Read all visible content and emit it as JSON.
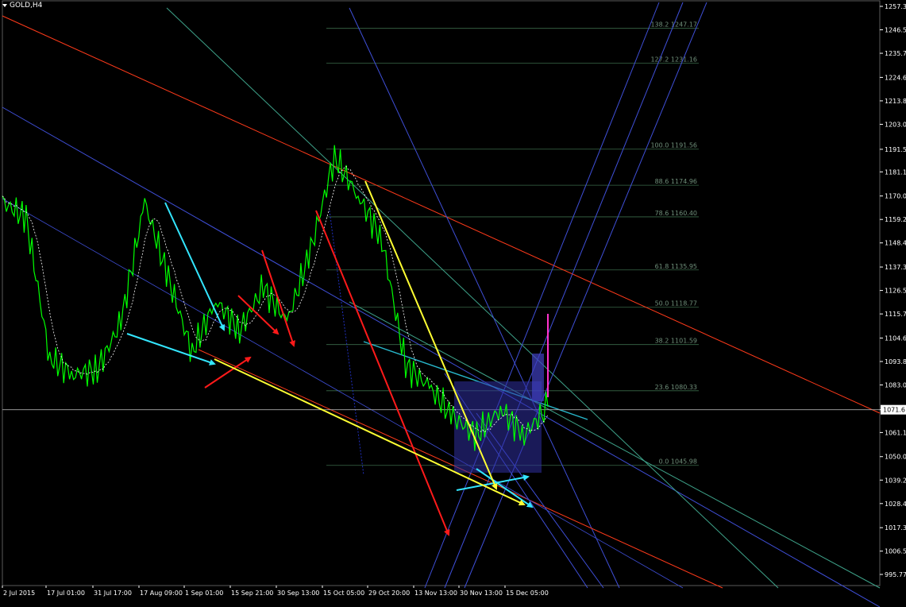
{
  "window": {
    "symbol_label": "GOLD,H4"
  },
  "chart_data": {
    "type": "line",
    "title": "GOLD,H4",
    "background": "#000000",
    "price_color": "#00ff00",
    "ylim": [
      995.77,
      1257.3
    ],
    "y_ticks": [
      "1257.3",
      "1246.5",
      "1235.7",
      "1224.6",
      "1213.8",
      "1203.0",
      "1191.5",
      "1181.1",
      "1170.0",
      "1159.2",
      "1148.4",
      "1137.3",
      "1126.5",
      "1115.7",
      "1104.6",
      "1093.8",
      "1083.0",
      "1071.6",
      "1061.1",
      "1050.0",
      "1039.2",
      "1028.4",
      "1017.3",
      "1006.5",
      "995.77"
    ],
    "current_price_label": "1071.6",
    "x_ticks": [
      "2 Jul 2015",
      "17 Jul 01:00",
      "31 Jul 17:00",
      "17 Aug 09:00",
      "1 Sep 01:00",
      "15 Sep 21:00",
      "30 Sep 13:00",
      "15 Oct 05:00",
      "29 Oct 20:00",
      "13 Nov 13:00",
      "30 Nov 13:00",
      "15 Dec 05:00"
    ],
    "series": [
      {
        "x": [
          "2 Jul 2015",
          "9 Jul",
          "17 Jul",
          "24 Jul",
          "31 Jul",
          "7 Aug",
          "17 Aug",
          "24 Aug",
          "1 Sep",
          "8 Sep",
          "15 Sep",
          "22 Sep",
          "30 Sep",
          "7 Oct",
          "15 Oct",
          "22 Oct",
          "29 Oct",
          "5 Nov",
          "13 Nov",
          "20 Nov",
          "30 Nov",
          "7 Dec",
          "15 Dec",
          "22 Dec"
        ],
        "values": [
          1167,
          1160,
          1095,
          1088,
          1090,
          1112,
          1167,
          1132,
          1098,
          1122,
          1108,
          1128,
          1112,
          1145,
          1188,
          1170,
          1150,
          1092,
          1082,
          1068,
          1060,
          1072,
          1060,
          1073
        ]
      }
    ],
    "fibonacci_levels": [
      {
        "label": "138.2",
        "value": "1247.17"
      },
      {
        "label": "127.2",
        "value": "1231.16"
      },
      {
        "label": "100.0",
        "value": "1191.56"
      },
      {
        "label": "88.6",
        "value": "1174.96"
      },
      {
        "label": "78.6",
        "value": "1160.40"
      },
      {
        "label": "61.8",
        "value": "1135.95"
      },
      {
        "label": "50.0",
        "value": "1118.77"
      },
      {
        "label": "38.2",
        "value": "1101.59"
      },
      {
        "label": "23.6",
        "value": "1080.33"
      },
      {
        "label": "0.0",
        "value": "1045.98"
      }
    ],
    "annotation_colors": {
      "red": "#ff1a1a",
      "yellow": "#ffff33",
      "cyan": "#33e6ff",
      "blue": "#3f4fd8",
      "teal": "#3ea38a",
      "orange_red": "#ff3a1a",
      "magenta": "#ff33cc",
      "white": "#ffffff"
    }
  }
}
